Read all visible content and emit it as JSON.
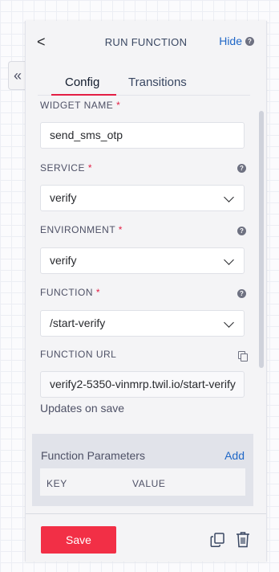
{
  "collapse_glyph": "«",
  "header": {
    "back_glyph": "<",
    "title": "RUN FUNCTION",
    "hide_label": "Hide",
    "help_glyph": "?"
  },
  "tabs": [
    {
      "label": "Config",
      "active": true
    },
    {
      "label": "Transitions",
      "active": false
    }
  ],
  "form": {
    "widget_name": {
      "label": "WIDGET NAME",
      "required_mark": "*",
      "value": "send_sms_otp"
    },
    "service": {
      "label": "SERVICE",
      "required_mark": "*",
      "value": "verify"
    },
    "environment": {
      "label": "ENVIRONMENT",
      "required_mark": "*",
      "value": "verify"
    },
    "function": {
      "label": "FUNCTION",
      "required_mark": "*",
      "value": "/start-verify"
    },
    "function_url": {
      "label": "FUNCTION URL",
      "value": "verify2-5350-vinmrp.twil.io/start-verify",
      "note": "Updates on save"
    }
  },
  "parameters": {
    "title": "Function Parameters",
    "add_label": "Add",
    "columns": [
      "KEY",
      "VALUE"
    ]
  },
  "footer": {
    "save_label": "Save"
  },
  "icons": {
    "duplicate": "duplicate-icon",
    "trash": "trash-icon",
    "copy": "copy-icon",
    "help": "help-icon"
  },
  "colors": {
    "accent": "#f22f46",
    "link": "#1f67c7",
    "tab_underline": "#e31e44"
  }
}
